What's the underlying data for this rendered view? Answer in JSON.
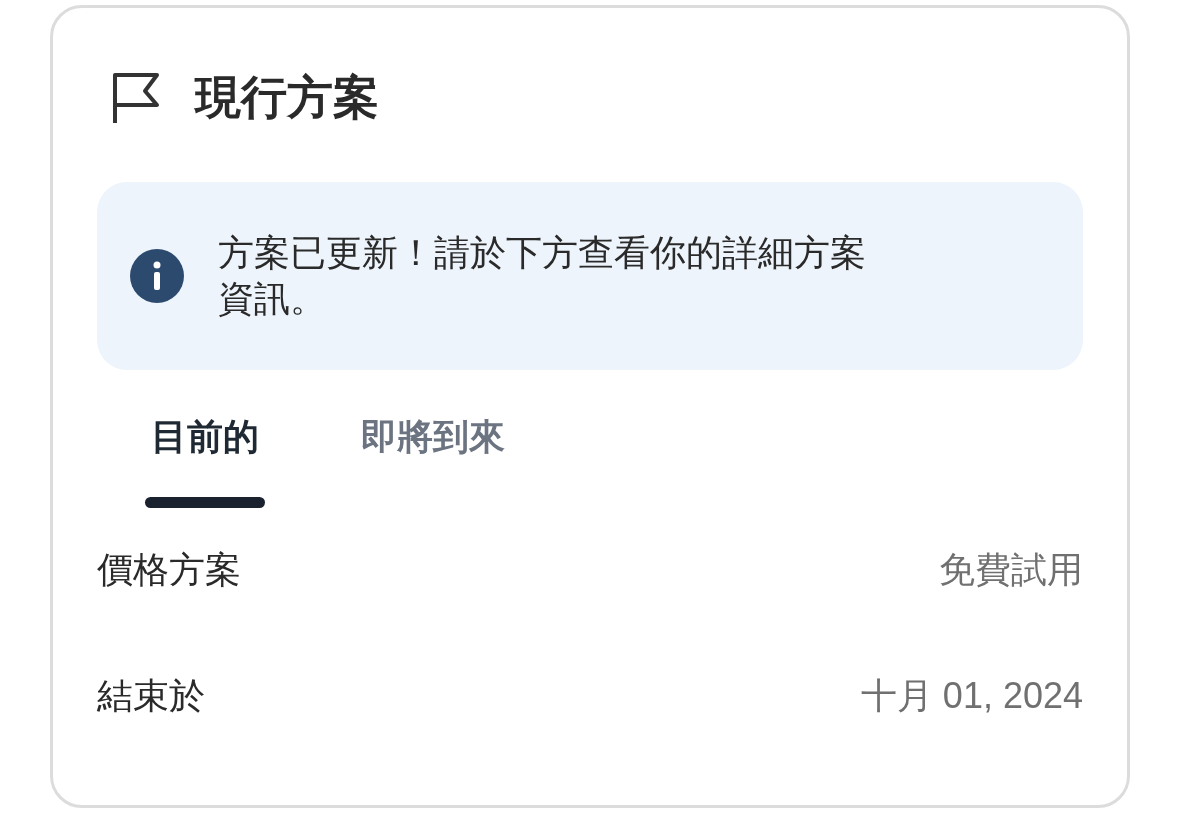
{
  "card": {
    "title": "現行方案"
  },
  "notice": {
    "text": "方案已更新！請於下方查看你的詳細方案資訊。"
  },
  "tabs": [
    {
      "label": "目前的",
      "selected": true
    },
    {
      "label": "即將到來",
      "selected": false
    }
  ],
  "details": [
    {
      "label": "價格方案",
      "value": "免費試用"
    },
    {
      "label": "結束於",
      "value": "十月 01, 2024"
    }
  ]
}
